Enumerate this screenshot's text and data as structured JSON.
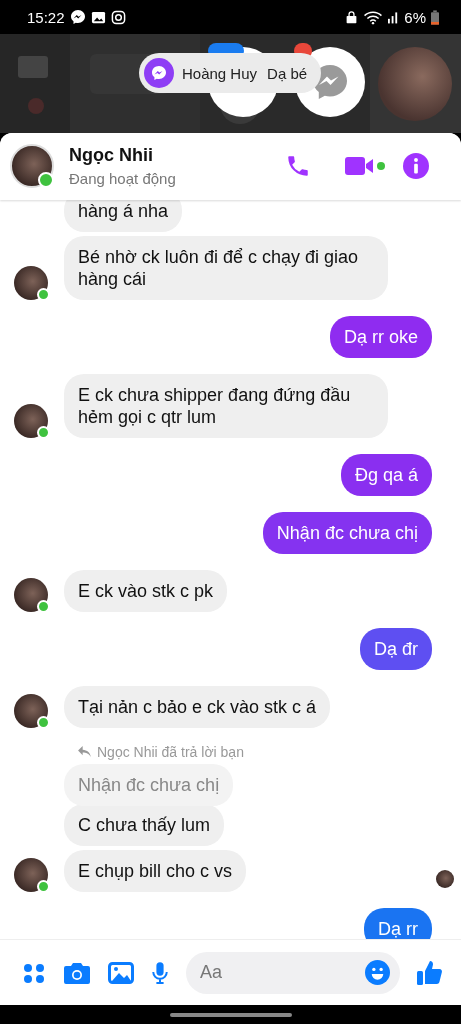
{
  "status_bar": {
    "time": "15:22",
    "battery": "6%"
  },
  "chat_head_popup": {
    "name": "Hoàng Huy",
    "preview": "Dạ bé"
  },
  "header": {
    "name": "Ngọc Nhii",
    "status": "Đang hoạt động"
  },
  "messages": [
    {
      "kind": "incoming",
      "text": "hàng á nha",
      "avatar": false
    },
    {
      "kind": "incoming",
      "text": "Bé nhờ ck luôn đi để c chạy đi giao hàng cái",
      "avatar": true
    },
    {
      "kind": "outgoing",
      "text": "Dạ rr oke",
      "color": "#8f2cf0"
    },
    {
      "kind": "incoming",
      "text": "E ck chưa shipper đang đứng đầu hẻm gọi c qtr lum",
      "avatar": true
    },
    {
      "kind": "outgoing",
      "text": "Đg qa á",
      "color": "#8a2ff0"
    },
    {
      "kind": "outgoing",
      "text": "Nhận đc chưa chị",
      "color": "#8533f0"
    },
    {
      "kind": "incoming",
      "text": "E ck vào stk c pk",
      "avatar": true
    },
    {
      "kind": "outgoing",
      "text": "Dạ đr",
      "color": "#5e4ff2"
    },
    {
      "kind": "incoming",
      "text": "Tại nản c bảo e ck vào stk c á",
      "avatar": true
    },
    {
      "kind": "reply_note",
      "text": "Ngọc Nhii đã trả lời bạn"
    },
    {
      "kind": "quoted",
      "text": "Nhận đc chưa chị"
    },
    {
      "kind": "incoming",
      "text": "C chưa thấy lum",
      "avatar": false
    },
    {
      "kind": "incoming",
      "text": "E chụp bill cho c vs",
      "avatar": true,
      "seen": true
    },
    {
      "kind": "outgoing",
      "text": "Dạ rr",
      "color": "#1a74f2"
    }
  ],
  "composer": {
    "placeholder": "Aa"
  }
}
